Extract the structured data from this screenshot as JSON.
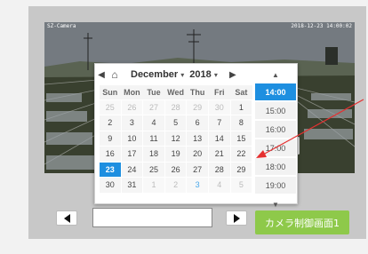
{
  "camera": {
    "overlay_left": "SZ-Camera",
    "overlay_right": "2018-12-23 14:00:02"
  },
  "calendar": {
    "month": "December",
    "year": "2018",
    "weekdays": [
      "Sun",
      "Mon",
      "Tue",
      "Wed",
      "Thu",
      "Fri",
      "Sat"
    ],
    "weeks": [
      [
        "25",
        "26",
        "27",
        "28",
        "29",
        "30",
        "1"
      ],
      [
        "2",
        "3",
        "4",
        "5",
        "6",
        "7",
        "8"
      ],
      [
        "9",
        "10",
        "11",
        "12",
        "13",
        "14",
        "15"
      ],
      [
        "16",
        "17",
        "18",
        "19",
        "20",
        "21",
        "22"
      ],
      [
        "23",
        "24",
        "25",
        "26",
        "27",
        "28",
        "29"
      ],
      [
        "30",
        "31",
        "1",
        "2",
        "3",
        "4",
        "5"
      ]
    ],
    "selected_day": "23"
  },
  "times": {
    "slots": [
      "14:00",
      "15:00",
      "16:00",
      "17:00",
      "18:00",
      "19:00"
    ],
    "selected": "14:00"
  },
  "date_input": {
    "value": ""
  },
  "camera_button": {
    "label": "カメラ制御画面1"
  },
  "colors": {
    "accent": "#1e8fe0",
    "camera_button": "#8ec94a",
    "annotation": "#e53030"
  }
}
